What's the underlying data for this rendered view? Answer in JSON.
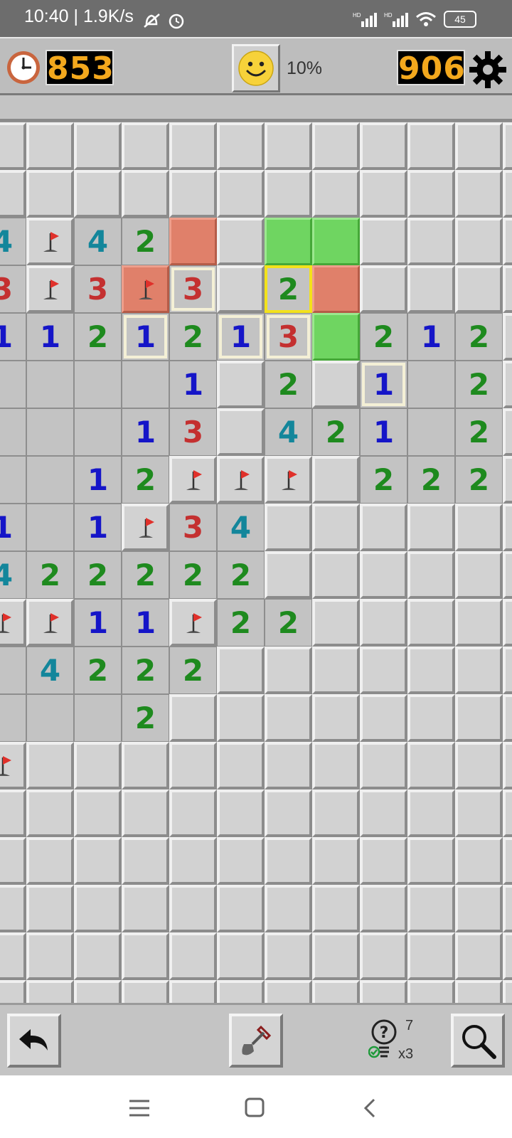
{
  "status_bar": {
    "time": "10:40",
    "speed": "1.9K/s",
    "battery": "45"
  },
  "header": {
    "timer": "853",
    "progress": "10%",
    "mines_left": "906"
  },
  "board": {
    "cols": 12,
    "rows": [
      [
        "h",
        "h",
        "h",
        "h",
        "h",
        "h",
        "h",
        "h",
        "h",
        "h",
        "h",
        "h"
      ],
      [
        "h",
        "h",
        "h",
        "h",
        "h",
        "h",
        "h",
        "h",
        "h",
        "h",
        "h",
        "h"
      ],
      [
        "4",
        "F",
        "4",
        "2",
        "R",
        "h",
        "G",
        "G",
        "h",
        "h",
        "h",
        "h"
      ],
      [
        "3",
        "F",
        "3",
        "RF",
        "3*",
        "h",
        "2y",
        "R",
        "h",
        "h",
        "h",
        "h"
      ],
      [
        "1",
        "1",
        "2",
        "1*",
        "2",
        "1*",
        "3*",
        "G",
        "2",
        "1",
        "2",
        "h"
      ],
      [
        "o",
        "o",
        "o",
        "o",
        "1",
        "h",
        "2",
        "h",
        "1*",
        "o",
        "2",
        "h"
      ],
      [
        "o",
        "o",
        "o",
        "1",
        "3",
        "h",
        "4",
        "2",
        "1",
        "o",
        "2",
        "h"
      ],
      [
        "o",
        "o",
        "1",
        "2",
        "F",
        "F",
        "F",
        "h",
        "2",
        "2",
        "2",
        "h"
      ],
      [
        "1",
        "o",
        "1",
        "F",
        "3",
        "4",
        "h",
        "h",
        "h",
        "h",
        "h",
        "h"
      ],
      [
        "4",
        "2",
        "2",
        "2",
        "2",
        "2",
        "h",
        "h",
        "h",
        "h",
        "h",
        "h"
      ],
      [
        "F",
        "F",
        "1",
        "1",
        "F",
        "2",
        "2",
        "h",
        "h",
        "h",
        "h",
        "h"
      ],
      [
        "o",
        "4",
        "2",
        "2",
        "2",
        "h",
        "h",
        "h",
        "h",
        "h",
        "h",
        "h"
      ],
      [
        "o",
        "o",
        "o",
        "2",
        "h",
        "h",
        "h",
        "h",
        "h",
        "h",
        "h",
        "h"
      ],
      [
        "F",
        "h",
        "h",
        "h",
        "h",
        "h",
        "h",
        "h",
        "h",
        "h",
        "h",
        "h"
      ],
      [
        "h",
        "h",
        "h",
        "h",
        "h",
        "h",
        "h",
        "h",
        "h",
        "h",
        "h",
        "h"
      ],
      [
        "h",
        "h",
        "h",
        "h",
        "h",
        "h",
        "h",
        "h",
        "h",
        "h",
        "h",
        "h"
      ],
      [
        "h",
        "h",
        "h",
        "h",
        "h",
        "h",
        "h",
        "h",
        "h",
        "h",
        "h",
        "h"
      ],
      [
        "h",
        "h",
        "h",
        "h",
        "h",
        "h",
        "h",
        "h",
        "h",
        "h",
        "h",
        "h"
      ],
      [
        "h",
        "h",
        "h",
        "h",
        "h",
        "h",
        "h",
        "h",
        "h",
        "h",
        "h",
        "h"
      ]
    ]
  },
  "toolbar": {
    "hint_count": "7",
    "hint_multiplier": "x3"
  },
  "icons": {
    "clock": "clock-icon",
    "smiley": "smiley-icon",
    "gear": "gear-icon",
    "undo": "undo-icon",
    "shovel": "shovel-icon",
    "hint": "lightbulb-icon",
    "zoom": "magnifier-icon"
  },
  "colors": {
    "lcd_digits": "#f3a81d",
    "mine_cell": "#e0806a",
    "safe_cell": "#6fd561",
    "highlight": "#f3e21b"
  }
}
